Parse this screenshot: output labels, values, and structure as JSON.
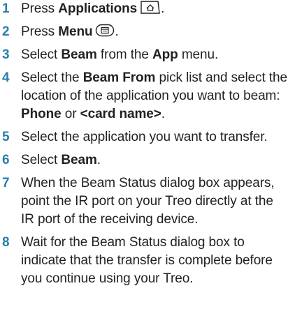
{
  "steps": [
    {
      "number": "1",
      "t1": "Press ",
      "b1": "Applications",
      "t2": "."
    },
    {
      "number": "2",
      "t1": "Press ",
      "b1": "Menu",
      "t2": "."
    },
    {
      "number": "3",
      "t1": "Select ",
      "b1": "Beam",
      "t2": " from the ",
      "b2": "App",
      "t3": " menu."
    },
    {
      "number": "4",
      "t1": "Select the ",
      "b1": "Beam From",
      "t2": " pick list and select the location of the application you want to beam: ",
      "b2": "Phone",
      "t3": " or ",
      "b3": "<card name>",
      "t4": "."
    },
    {
      "number": "5",
      "t1": "Select the application you want to transfer."
    },
    {
      "number": "6",
      "t1": "Select ",
      "b1": "Beam",
      "t2": "."
    },
    {
      "number": "7",
      "t1": "When the Beam Status dialog box appears, point the IR port on your Treo directly at the IR port of the receiving device."
    },
    {
      "number": "8",
      "t1": "Wait for the Beam Status dialog box to indicate that the transfer is complete before you continue using your Treo."
    }
  ],
  "icons": {
    "applications": "applications-key-icon",
    "menu": "menu-key-icon"
  },
  "colors": {
    "step_number": "#2a7fa8",
    "text": "#231f20"
  }
}
